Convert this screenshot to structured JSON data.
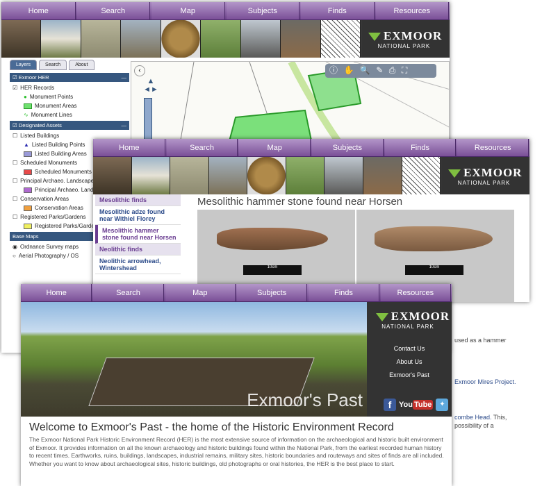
{
  "nav": [
    "Home",
    "Search",
    "Map",
    "Subjects",
    "Finds",
    "Resources"
  ],
  "logo": {
    "title": "EXMOOR",
    "subtitle": "NATIONAL PARK"
  },
  "layers": {
    "tabs": [
      "Layers",
      "Search",
      "About"
    ],
    "group1": "Exmoor HER",
    "her_records": "HER Records",
    "her_items": [
      "Monument Points",
      "Monument Areas",
      "Monument Lines"
    ],
    "group2": "Designated Assets",
    "sub": [
      {
        "label": "Listed Buildings",
        "items": [
          "Listed Building Points",
          "Listed Building Areas"
        ]
      },
      {
        "label": "Scheduled Monuments",
        "items": [
          "Scheduled Monuments"
        ]
      },
      {
        "label": "Principal Archaeo. Landscapes",
        "items": [
          "Principal Archaeo. Landscapes"
        ]
      },
      {
        "label": "Conservation Areas",
        "items": [
          "Conservation Areas"
        ]
      },
      {
        "label": "Registered Parks/Gardens",
        "items": [
          "Registered Parks/Gardens"
        ]
      }
    ],
    "basemaps": "Base Maps",
    "os": "Ordnance Survey maps",
    "aerial": "Aerial Photography / OS"
  },
  "finds": {
    "heading1": "Mesolithic finds",
    "item1": "Mesolithic adze found near Withiel Florey",
    "item2": "Mesolithic hammer stone found near Horsen",
    "heading2": "Neolithic finds",
    "item3": "Neolithic arrowhead, Wintershead",
    "title": "Mesolithic hammer stone found near Horsen",
    "scale": "10cm"
  },
  "home": {
    "contact": "Contact Us",
    "about": "About Us",
    "past": "Exmoor's Past",
    "hero_caption": "Exmoor's Past",
    "youtube": "You",
    "tube": "Tube",
    "heading": "Welcome to Exmoor's Past - the home of the Historic Environment Record",
    "body": "The Exmoor National Park Historic Environment Record (HER) is the most extensive source of information on the archaeological and historic built environment of Exmoor. It provides information on all the known archaeology and historic buildings found within the National Park, from the earliest recorded human history to recent times. Earthworks, ruins, buildings, landscapes, industrial remains, military sites, historic boundaries and routeways and sites of finds are all included. Whether you want to know about archaeological sites, historic buildings, old photographs or oral histories, the HER is the best place to start."
  },
  "peek": {
    "hammer": "used as a hammer",
    "mires": "Exmoor Mires Project.",
    "combe": "combe Head.",
    "this": " This,",
    "possibility": "possibility of a"
  },
  "colors": {
    "nav": "#7a4f97",
    "panel": "#36577f",
    "accent": "#6a3d91"
  }
}
